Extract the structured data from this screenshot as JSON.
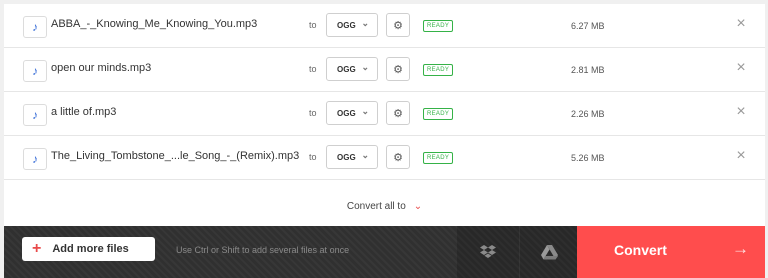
{
  "files": [
    {
      "name": "ABBA_-_Knowing_Me_Knowing_You.mp3",
      "to": "to",
      "format": "OGG",
      "status": "READY",
      "size": "6.27 MB"
    },
    {
      "name": "open our minds.mp3",
      "to": "to",
      "format": "OGG",
      "status": "READY",
      "size": "2.81 MB"
    },
    {
      "name": "a little of.mp3",
      "to": "to",
      "format": "OGG",
      "status": "READY",
      "size": "2.26 MB"
    },
    {
      "name": "The_Living_Tombstone_...le_Song_-_(Remix).mp3",
      "to": "to",
      "format": "OGG",
      "status": "READY",
      "size": "5.26 MB"
    }
  ],
  "icons": {
    "file": "music-note-icon",
    "chevron": "chevron-down-icon",
    "settings": "gear-icon",
    "remove": "close-icon",
    "add": "plus-icon",
    "dropbox": "dropbox-icon",
    "gdrive": "google-drive-icon",
    "arrow": "arrow-right-icon"
  },
  "convert_all": {
    "label": "Convert all to"
  },
  "bottom_bar": {
    "add_files_label": "Add more files",
    "hint": "Use Ctrl or Shift to add several files at once",
    "convert_label": "Convert"
  },
  "colors": {
    "accent_red": "#ff4d4d",
    "ready_green": "#35b247",
    "bar_dark": "#303030"
  }
}
